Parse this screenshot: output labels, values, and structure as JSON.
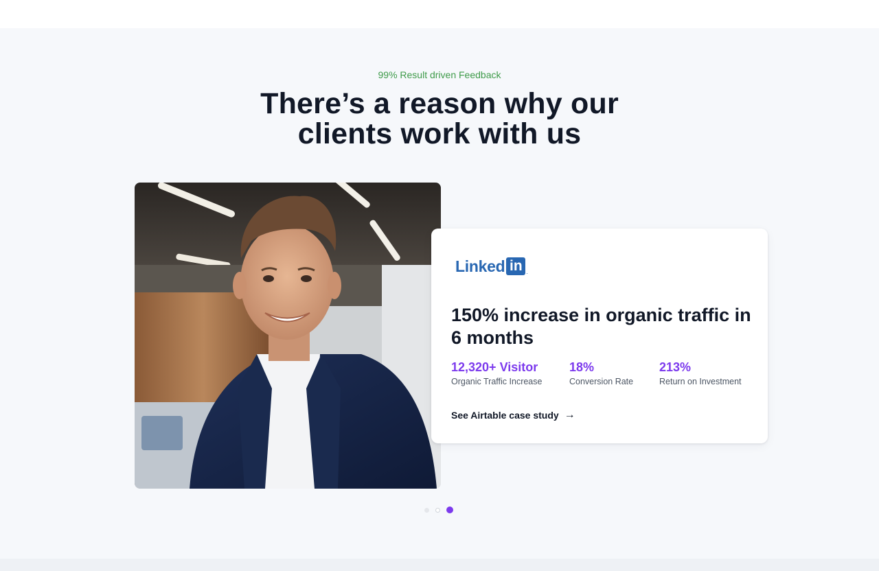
{
  "section": {
    "eyebrow": "99% Result driven Feedback",
    "headline_line1": "There’s a reason why our",
    "headline_line2": "clients work with us"
  },
  "testimonial": {
    "photo_alt": "smiling man in navy blazer",
    "logo": {
      "word": "Linked",
      "box": "in",
      "dot": "."
    },
    "title": "150% increase in organic traffic in 6 months",
    "stats": [
      {
        "value": "12,320+ Visitor",
        "label": "Organic Traffic Increase"
      },
      {
        "value": "18%",
        "label": "Conversion Rate"
      },
      {
        "value": "213%",
        "label": "Return on Investment"
      }
    ],
    "cta_label": "See Airtable case study",
    "cta_icon": "arrow-right-icon"
  },
  "carousel": {
    "total": 3,
    "active_index": 3
  },
  "colors": {
    "accent": "#7c3aed",
    "eyebrow": "#3f9b4a",
    "linkedin": "#2867b2",
    "background": "#f6f8fb"
  }
}
